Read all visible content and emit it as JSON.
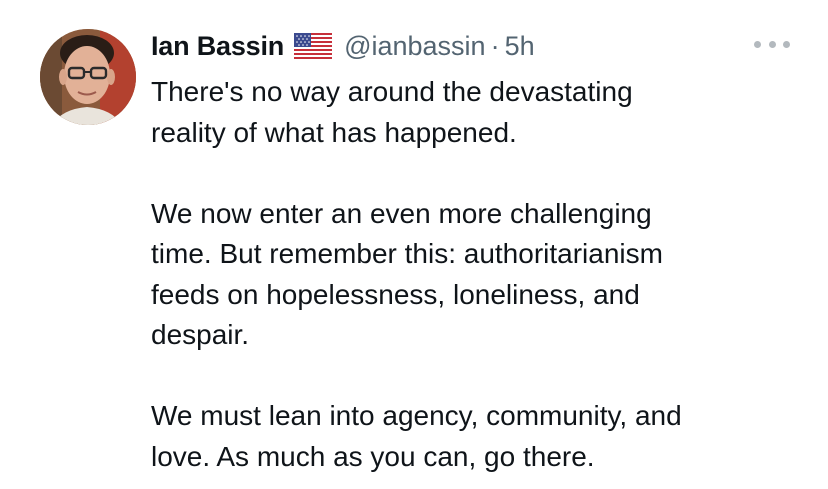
{
  "tweet": {
    "author_name": "Ian Bassin",
    "flag_icon": "us-flag-icon",
    "handle": "@ianbassin",
    "separator": "·",
    "timestamp": "5h",
    "more_icon": "more-horizontal-icon",
    "avatar_icon": "profile-photo",
    "paragraphs": [
      {
        "lines": [
          "There's no way around the devastating",
          "reality of what has happened."
        ]
      },
      {
        "lines": [
          "We now enter an even more challenging",
          "time. But remember this: authoritarianism",
          "feeds on hopelessness, loneliness, and",
          "despair."
        ]
      },
      {
        "lines": [
          "We must lean into agency, community, and",
          "love. As much as you can, go there."
        ]
      }
    ]
  },
  "colors": {
    "text_primary": "#0f1419",
    "text_secondary": "#536471",
    "background": "#ffffff"
  }
}
